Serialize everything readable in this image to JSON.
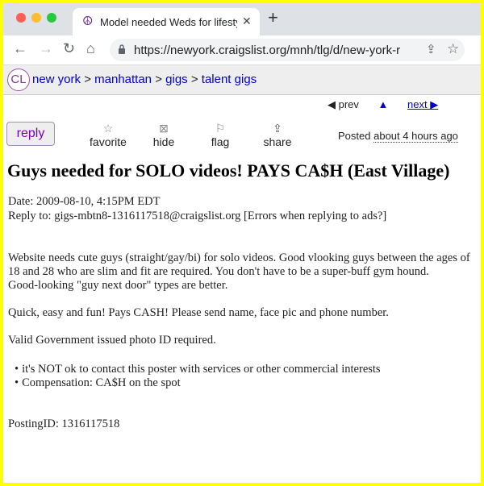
{
  "browser": {
    "tab_title": "Model needed Weds for lifestyl",
    "new_tab_glyph": "+",
    "url": "https://newyork.craigslist.org/mnh/tlg/d/new-york-r"
  },
  "header": {
    "logo": "CL",
    "breadcrumbs": [
      "new york",
      "manhattan",
      "gigs",
      "talent gigs"
    ],
    "separator": ">"
  },
  "nav": {
    "prev": "prev",
    "up": "▲",
    "next": "next ▶"
  },
  "actions": {
    "reply": "reply",
    "favorite": "favorite",
    "hide": "hide",
    "flag": "flag",
    "share": "share"
  },
  "posted": {
    "label": "Posted",
    "ago": "about 4 hours ago"
  },
  "posting": {
    "title": "Guys needed for SOLO videos! PAYS CA$H (East Village)",
    "date": "Date: 2009-08-10, 4:15PM EDT",
    "reply_to": "Reply to: gigs-mbtn8-1316117518@craigslist.org [Errors when replying to ads?]",
    "body_lines": [
      "Website needs cute guys (straight/gay/bi) for solo videos. Good vlooking guys between the ages of",
      "18 and 28 who are slim and fit are required.  You don't have to be a super-buff gym hound.",
      "Good-looking \"guy next door\" types are better."
    ],
    "paragraph2": "Quick, easy and fun! Pays CASH! Please send name, face pic and phone number.",
    "paragraph3": "Valid Government issued photo ID required.",
    "bullets": [
      "it's NOT ok to contact this poster with services or other commercial interests",
      "Compensation: CA$H on the spot"
    ],
    "posting_id": "PostingID: 1316117518"
  },
  "colors": {
    "link": "#0000cc",
    "reply": "#7f00b3",
    "highlight_border": "#ffff00"
  }
}
